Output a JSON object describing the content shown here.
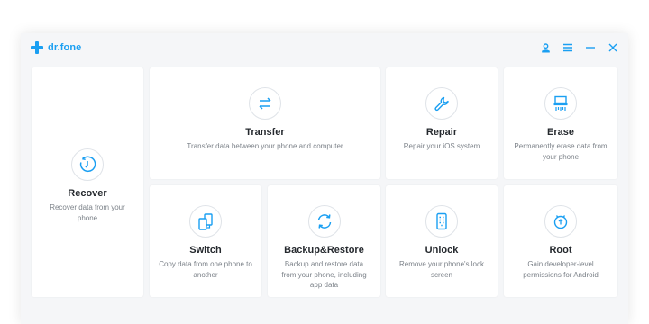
{
  "app": {
    "name": "dr.fone"
  },
  "window_controls": [
    "account-icon",
    "menu-icon",
    "minimize-icon",
    "close-icon"
  ],
  "accent_color": "#1a9ff2",
  "cards": {
    "recover": {
      "title": "Recover",
      "desc": "Recover data from your phone",
      "icon": "recover-icon"
    },
    "transfer": {
      "title": "Transfer",
      "desc": "Transfer data between your phone and computer",
      "icon": "transfer-icon"
    },
    "repair": {
      "title": "Repair",
      "desc": "Repair your iOS system",
      "icon": "repair-icon"
    },
    "erase": {
      "title": "Erase",
      "desc": "Permanently erase data from your phone",
      "icon": "erase-icon"
    },
    "switch": {
      "title": "Switch",
      "desc": "Copy data from one phone to another",
      "icon": "switch-icon"
    },
    "backup": {
      "title": "Backup&Restore",
      "desc": "Backup and restore data from your phone, including app data",
      "icon": "backup-icon"
    },
    "unlock": {
      "title": "Unlock",
      "desc": "Remove your phone's lock screen",
      "icon": "unlock-icon"
    },
    "root": {
      "title": "Root",
      "desc": "Gain developer-level permissions for Android",
      "icon": "root-icon"
    }
  }
}
